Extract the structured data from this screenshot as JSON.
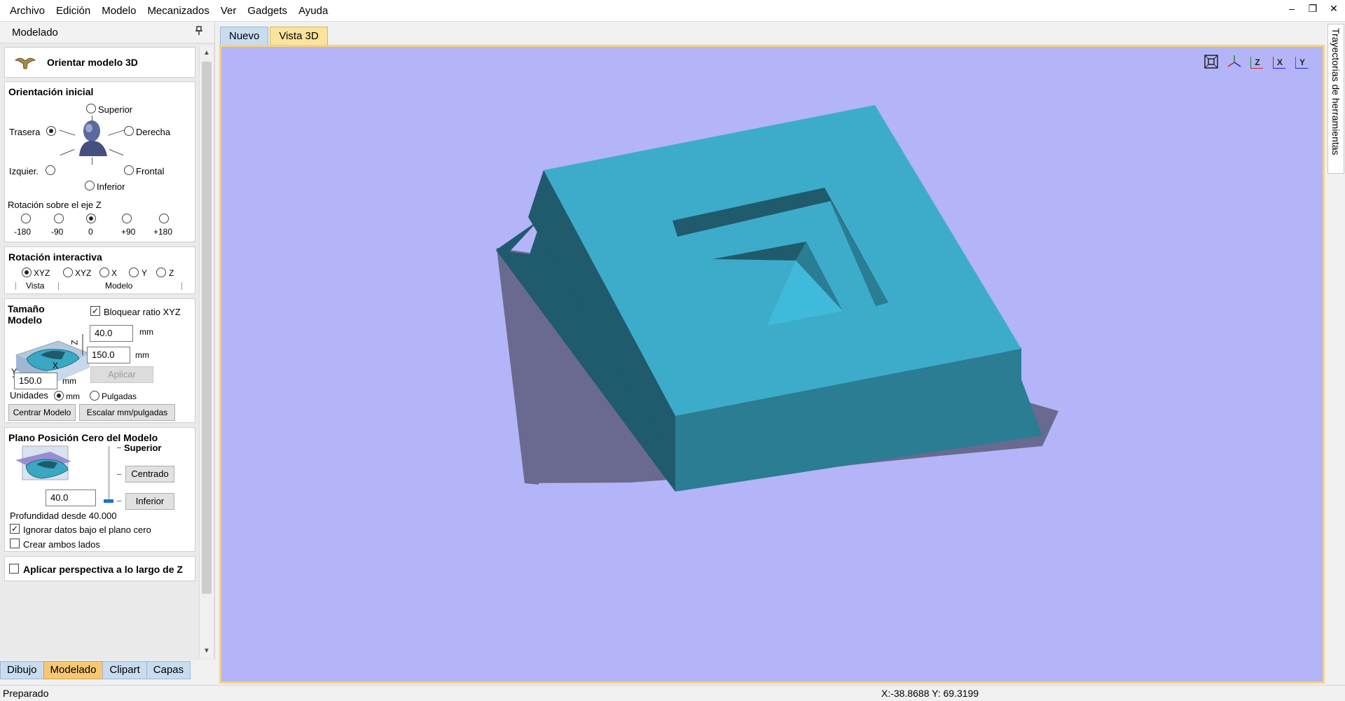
{
  "menu": [
    "Archivo",
    "Edición",
    "Modelo",
    "Mecanizados",
    "Ver",
    "Gadgets",
    "Ayuda"
  ],
  "window_controls": {
    "minimize": "–",
    "restore": "❐",
    "close": "✕"
  },
  "panel": {
    "title": "Modelado",
    "pin": "📌"
  },
  "orient_header": {
    "title": "Orientar modelo 3D"
  },
  "orientacion": {
    "title": "Orientación inicial",
    "superior": "Superior",
    "trasera": "Trasera",
    "derecha": "Derecha",
    "izquier": "Izquier.",
    "frontal": "Frontal",
    "inferior": "Inferior",
    "rot_z_label": "Rotación sobre el eje Z",
    "rot_options": [
      "-180",
      "-90",
      "0",
      "+90",
      "+180"
    ],
    "selected_side": "Trasera",
    "selected_rot": "0"
  },
  "rotacion": {
    "title": "Rotación interactiva",
    "options": [
      "XYZ",
      "XYZ",
      "X",
      "Y",
      "Z"
    ],
    "selected": 0,
    "vista": "Vista",
    "modelo": "Modelo"
  },
  "tamano": {
    "title_line1": "Tamaño",
    "title_line2": "Modelo",
    "lock_label": "Bloquear ratio XYZ",
    "lock_checked": true,
    "z_value": "40.0",
    "x_value": "150.0",
    "y_value": "150.0",
    "unit_mm": "mm",
    "axis_z": "Z",
    "axis_x": "X",
    "axis_y": "Y",
    "apply": "Aplicar",
    "units_label": "Unidades",
    "unit_option_mm": "mm",
    "unit_option_in": "Pulgadas",
    "center_button": "Centrar Modelo",
    "scale_button": "Escalar mm/pulgadas"
  },
  "plano": {
    "title": "Plano Posición Cero del Modelo",
    "superior": "Superior",
    "centrado": "Centrado",
    "inferior": "Inferior",
    "value": "40.0",
    "profundidad": "Profundidad desde 40.000",
    "ignorar": "Ignorar datos bajo el plano cero",
    "ignorar_checked": true,
    "crear": "Crear ambos lados",
    "crear_checked": false
  },
  "perspectiva": {
    "label": "Aplicar perspectiva a lo largo de Z",
    "checked": false
  },
  "left_tabs": [
    "Dibujo",
    "Modelado",
    "Clipart",
    "Capas"
  ],
  "left_tab_active": 1,
  "doc_tabs": [
    "Nuevo",
    "Vista 3D"
  ],
  "doc_tab_active": 1,
  "view_icons": {
    "fit": "fit-view-icon",
    "iso": "iso-view-icon",
    "z": "Z",
    "x": "X",
    "y": "Y"
  },
  "right_panel": {
    "label": "Trayectorias de herramientas"
  },
  "status": {
    "text": "Preparado",
    "coords": "X:-38.8688 Y: 69.3199"
  },
  "colors": {
    "viewport_bg": "#b4b4f8",
    "model_top": "#3daccb",
    "model_left": "#1f5b6c",
    "model_front": "#2a7d92",
    "base_plane": "#6a6a90",
    "tab_active": "#f7c873",
    "tab_inactive": "#c8dcf0"
  }
}
